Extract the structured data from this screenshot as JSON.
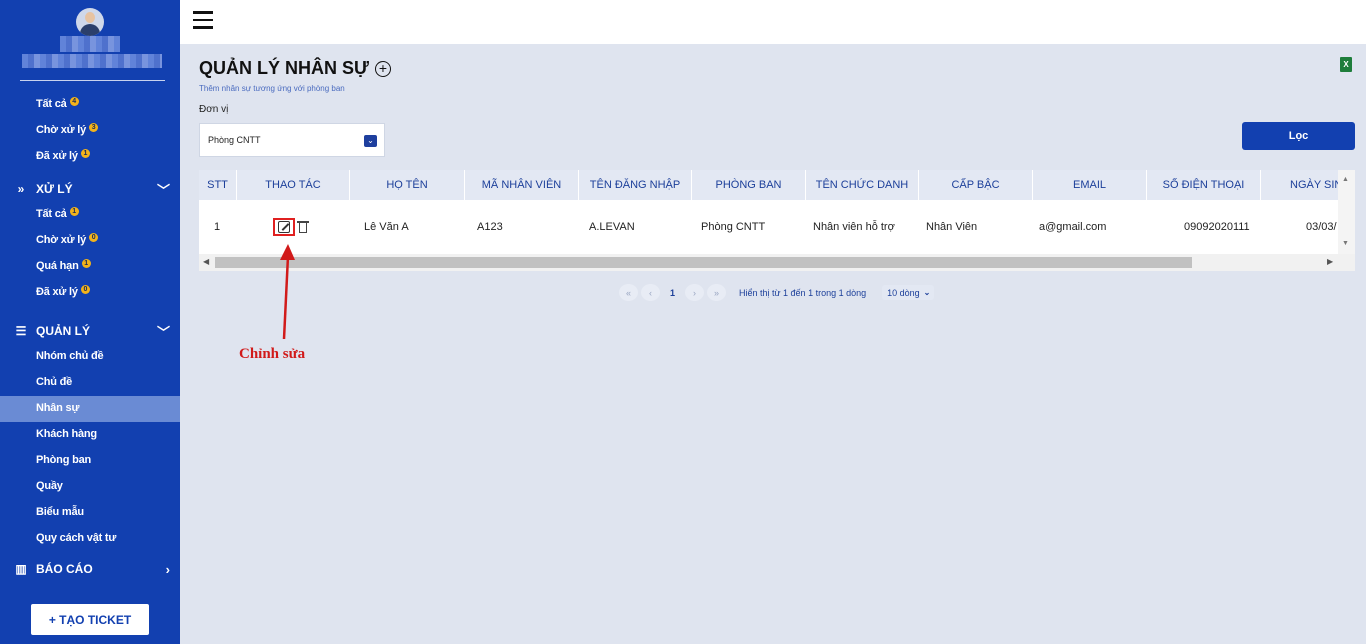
{
  "sidebar": {
    "nav_top": [
      {
        "label": "Tất cả",
        "badge": "4"
      },
      {
        "label": "Chờ xử lý",
        "badge": "3"
      },
      {
        "label": "Đã xử lý",
        "badge": "1"
      }
    ],
    "section_xuly": {
      "title": "XỬ LÝ",
      "icon": "double-chevron-right-icon",
      "items": [
        {
          "label": "Tất cả",
          "badge": "1"
        },
        {
          "label": "Chờ xử lý",
          "badge": "0"
        },
        {
          "label": "Quá hạn",
          "badge": "1"
        },
        {
          "label": "Đã xử lý",
          "badge": "0"
        }
      ]
    },
    "section_quanly": {
      "title": "QUẢN LÝ",
      "icon": "list-align-icon",
      "items": [
        {
          "label": "Nhóm chủ đề"
        },
        {
          "label": "Chủ đề"
        },
        {
          "label": "Nhân sự",
          "active": true
        },
        {
          "label": "Khách hàng"
        },
        {
          "label": "Phòng ban"
        },
        {
          "label": "Quầy"
        },
        {
          "label": "Biểu mẫu"
        },
        {
          "label": "Quy cách vật tư"
        }
      ]
    },
    "section_baocao": {
      "title": "BÁO CÁO",
      "icon": "bar-chart-icon"
    },
    "ticket_button": "+ TẠO TICKET",
    "colors": {
      "background": "#1240b0",
      "active": "#6a8bd4",
      "badge": "#f3b31a"
    }
  },
  "main": {
    "title": "QUẢN LÝ NHÂN SỰ",
    "subtitle": "Thêm nhân sự tương ứng với phòng ban",
    "unit_label": "Đơn vị",
    "unit_value": "Phòng CNTT",
    "filter_button": "Lọc",
    "excel_icon_text": "X"
  },
  "table": {
    "headers": [
      "STT",
      "THAO TÁC",
      "HỌ TÊN",
      "MÃ NHÂN VIÊN",
      "TÊN ĐĂNG NHẬP",
      "PHÒNG BAN",
      "TÊN CHỨC DANH",
      "CẤP BẬC",
      "EMAIL",
      "SỐ ĐIỆN THOẠI",
      "NGÀY SIN"
    ],
    "rows": [
      [
        "1",
        "",
        "Lê Văn A",
        "A123",
        "A.LEVAN",
        "Phòng CNTT",
        "Nhân viên hỗ trợ",
        "Nhân Viên",
        "a@gmail.com",
        "09092020111",
        "03/03/"
      ]
    ]
  },
  "pagination": {
    "first": "«",
    "prev": "‹",
    "current": "1",
    "next": "›",
    "last": "»",
    "info": "Hiển thị từ 1 đến 1 trong 1 dòng",
    "page_size": "10 dòng"
  },
  "annotation": {
    "label": "Chỉnh sửa",
    "color": "#d11a1a"
  }
}
